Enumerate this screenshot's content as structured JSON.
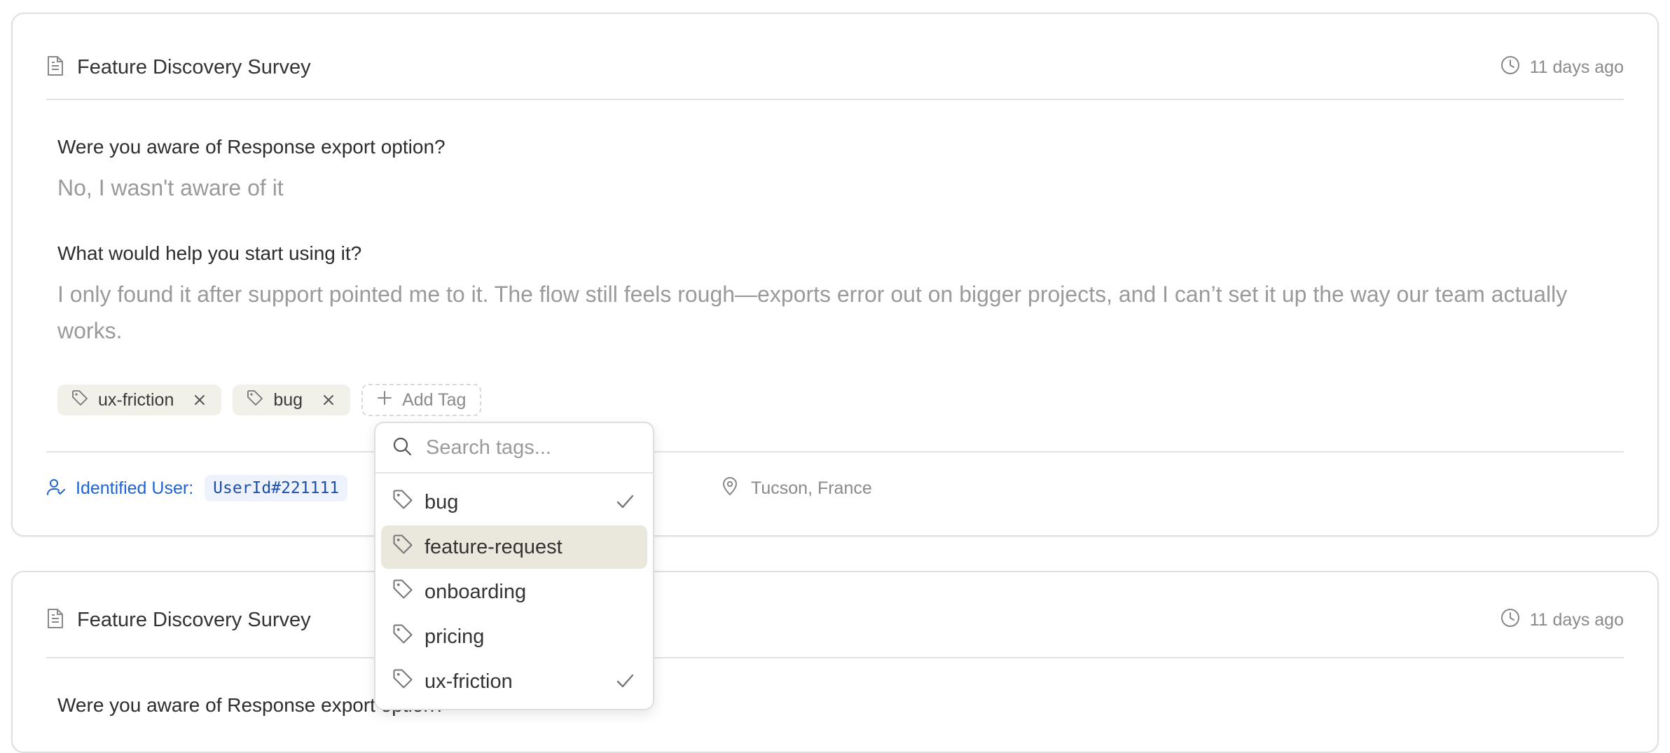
{
  "card1": {
    "title": "Feature Discovery Survey",
    "time": "11 days ago",
    "q1": "Were you aware of Response export option?",
    "a1": "No, I wasn't aware of it",
    "q2": "What would help you start using it?",
    "a2": "I only found it after support pointed me to it. The flow still feels rough—exports error out on bigger projects, and I can’t set it up the way our team actually works.",
    "tags": [
      "ux-friction",
      "bug"
    ],
    "add_tag_label": "Add Tag",
    "user_label": "Identified User:",
    "user_id": "UserId#221111",
    "location": "Tucson, France"
  },
  "dropdown": {
    "search_placeholder": "Search tags...",
    "options": [
      {
        "label": "bug",
        "checked": true
      },
      {
        "label": "feature-request",
        "checked": false
      },
      {
        "label": "onboarding",
        "checked": false
      },
      {
        "label": "pricing",
        "checked": false
      },
      {
        "label": "ux-friction",
        "checked": true
      }
    ]
  },
  "card2": {
    "title": "Feature Discovery Survey",
    "time": "11 days ago",
    "q1": "Were you aware of Response export option?"
  },
  "icons": {
    "document": "document-icon",
    "clock": "clock-icon",
    "tag": "tag-icon",
    "close": "close-icon",
    "plus": "plus-icon",
    "search": "search-icon",
    "check": "check-icon",
    "user": "user-check-icon",
    "location": "map-pin-icon"
  },
  "colors": {
    "accent_blue": "#1f63d6",
    "tag_bg": "#f1f0e9",
    "highlight_bg": "#eae7dc"
  }
}
